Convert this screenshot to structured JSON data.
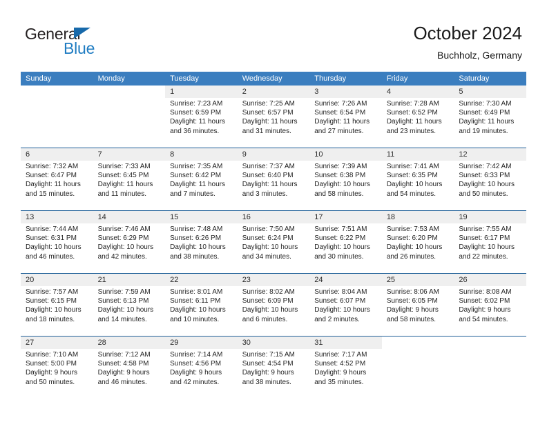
{
  "brand": {
    "name_top": "General",
    "name_bottom": "Blue",
    "accent_color": "#1f7cc2",
    "triangle_color": "#1769aa"
  },
  "header": {
    "title": "October 2024",
    "subtitle": "Buchholz, Germany"
  },
  "calendar": {
    "header_bg": "#3b7ebf",
    "date_band_bg": "#efefef",
    "week_rule_color": "#1a5c96",
    "weekdays": [
      "Sunday",
      "Monday",
      "Tuesday",
      "Wednesday",
      "Thursday",
      "Friday",
      "Saturday"
    ],
    "labels": {
      "sunrise": "Sunrise:",
      "sunset": "Sunset:",
      "daylight": "Daylight:"
    },
    "weeks": [
      [
        {
          "day": ""
        },
        {
          "day": ""
        },
        {
          "day": "1",
          "sunrise": "Sunrise: 7:23 AM",
          "sunset": "Sunset: 6:59 PM",
          "daylight1": "Daylight: 11 hours",
          "daylight2": "and 36 minutes."
        },
        {
          "day": "2",
          "sunrise": "Sunrise: 7:25 AM",
          "sunset": "Sunset: 6:57 PM",
          "daylight1": "Daylight: 11 hours",
          "daylight2": "and 31 minutes."
        },
        {
          "day": "3",
          "sunrise": "Sunrise: 7:26 AM",
          "sunset": "Sunset: 6:54 PM",
          "daylight1": "Daylight: 11 hours",
          "daylight2": "and 27 minutes."
        },
        {
          "day": "4",
          "sunrise": "Sunrise: 7:28 AM",
          "sunset": "Sunset: 6:52 PM",
          "daylight1": "Daylight: 11 hours",
          "daylight2": "and 23 minutes."
        },
        {
          "day": "5",
          "sunrise": "Sunrise: 7:30 AM",
          "sunset": "Sunset: 6:49 PM",
          "daylight1": "Daylight: 11 hours",
          "daylight2": "and 19 minutes."
        }
      ],
      [
        {
          "day": "6",
          "sunrise": "Sunrise: 7:32 AM",
          "sunset": "Sunset: 6:47 PM",
          "daylight1": "Daylight: 11 hours",
          "daylight2": "and 15 minutes."
        },
        {
          "day": "7",
          "sunrise": "Sunrise: 7:33 AM",
          "sunset": "Sunset: 6:45 PM",
          "daylight1": "Daylight: 11 hours",
          "daylight2": "and 11 minutes."
        },
        {
          "day": "8",
          "sunrise": "Sunrise: 7:35 AM",
          "sunset": "Sunset: 6:42 PM",
          "daylight1": "Daylight: 11 hours",
          "daylight2": "and 7 minutes."
        },
        {
          "day": "9",
          "sunrise": "Sunrise: 7:37 AM",
          "sunset": "Sunset: 6:40 PM",
          "daylight1": "Daylight: 11 hours",
          "daylight2": "and 3 minutes."
        },
        {
          "day": "10",
          "sunrise": "Sunrise: 7:39 AM",
          "sunset": "Sunset: 6:38 PM",
          "daylight1": "Daylight: 10 hours",
          "daylight2": "and 58 minutes."
        },
        {
          "day": "11",
          "sunrise": "Sunrise: 7:41 AM",
          "sunset": "Sunset: 6:35 PM",
          "daylight1": "Daylight: 10 hours",
          "daylight2": "and 54 minutes."
        },
        {
          "day": "12",
          "sunrise": "Sunrise: 7:42 AM",
          "sunset": "Sunset: 6:33 PM",
          "daylight1": "Daylight: 10 hours",
          "daylight2": "and 50 minutes."
        }
      ],
      [
        {
          "day": "13",
          "sunrise": "Sunrise: 7:44 AM",
          "sunset": "Sunset: 6:31 PM",
          "daylight1": "Daylight: 10 hours",
          "daylight2": "and 46 minutes."
        },
        {
          "day": "14",
          "sunrise": "Sunrise: 7:46 AM",
          "sunset": "Sunset: 6:29 PM",
          "daylight1": "Daylight: 10 hours",
          "daylight2": "and 42 minutes."
        },
        {
          "day": "15",
          "sunrise": "Sunrise: 7:48 AM",
          "sunset": "Sunset: 6:26 PM",
          "daylight1": "Daylight: 10 hours",
          "daylight2": "and 38 minutes."
        },
        {
          "day": "16",
          "sunrise": "Sunrise: 7:50 AM",
          "sunset": "Sunset: 6:24 PM",
          "daylight1": "Daylight: 10 hours",
          "daylight2": "and 34 minutes."
        },
        {
          "day": "17",
          "sunrise": "Sunrise: 7:51 AM",
          "sunset": "Sunset: 6:22 PM",
          "daylight1": "Daylight: 10 hours",
          "daylight2": "and 30 minutes."
        },
        {
          "day": "18",
          "sunrise": "Sunrise: 7:53 AM",
          "sunset": "Sunset: 6:20 PM",
          "daylight1": "Daylight: 10 hours",
          "daylight2": "and 26 minutes."
        },
        {
          "day": "19",
          "sunrise": "Sunrise: 7:55 AM",
          "sunset": "Sunset: 6:17 PM",
          "daylight1": "Daylight: 10 hours",
          "daylight2": "and 22 minutes."
        }
      ],
      [
        {
          "day": "20",
          "sunrise": "Sunrise: 7:57 AM",
          "sunset": "Sunset: 6:15 PM",
          "daylight1": "Daylight: 10 hours",
          "daylight2": "and 18 minutes."
        },
        {
          "day": "21",
          "sunrise": "Sunrise: 7:59 AM",
          "sunset": "Sunset: 6:13 PM",
          "daylight1": "Daylight: 10 hours",
          "daylight2": "and 14 minutes."
        },
        {
          "day": "22",
          "sunrise": "Sunrise: 8:01 AM",
          "sunset": "Sunset: 6:11 PM",
          "daylight1": "Daylight: 10 hours",
          "daylight2": "and 10 minutes."
        },
        {
          "day": "23",
          "sunrise": "Sunrise: 8:02 AM",
          "sunset": "Sunset: 6:09 PM",
          "daylight1": "Daylight: 10 hours",
          "daylight2": "and 6 minutes."
        },
        {
          "day": "24",
          "sunrise": "Sunrise: 8:04 AM",
          "sunset": "Sunset: 6:07 PM",
          "daylight1": "Daylight: 10 hours",
          "daylight2": "and 2 minutes."
        },
        {
          "day": "25",
          "sunrise": "Sunrise: 8:06 AM",
          "sunset": "Sunset: 6:05 PM",
          "daylight1": "Daylight: 9 hours",
          "daylight2": "and 58 minutes."
        },
        {
          "day": "26",
          "sunrise": "Sunrise: 8:08 AM",
          "sunset": "Sunset: 6:02 PM",
          "daylight1": "Daylight: 9 hours",
          "daylight2": "and 54 minutes."
        }
      ],
      [
        {
          "day": "27",
          "sunrise": "Sunrise: 7:10 AM",
          "sunset": "Sunset: 5:00 PM",
          "daylight1": "Daylight: 9 hours",
          "daylight2": "and 50 minutes."
        },
        {
          "day": "28",
          "sunrise": "Sunrise: 7:12 AM",
          "sunset": "Sunset: 4:58 PM",
          "daylight1": "Daylight: 9 hours",
          "daylight2": "and 46 minutes."
        },
        {
          "day": "29",
          "sunrise": "Sunrise: 7:14 AM",
          "sunset": "Sunset: 4:56 PM",
          "daylight1": "Daylight: 9 hours",
          "daylight2": "and 42 minutes."
        },
        {
          "day": "30",
          "sunrise": "Sunrise: 7:15 AM",
          "sunset": "Sunset: 4:54 PM",
          "daylight1": "Daylight: 9 hours",
          "daylight2": "and 38 minutes."
        },
        {
          "day": "31",
          "sunrise": "Sunrise: 7:17 AM",
          "sunset": "Sunset: 4:52 PM",
          "daylight1": "Daylight: 9 hours",
          "daylight2": "and 35 minutes."
        },
        {
          "day": ""
        },
        {
          "day": ""
        }
      ]
    ]
  }
}
